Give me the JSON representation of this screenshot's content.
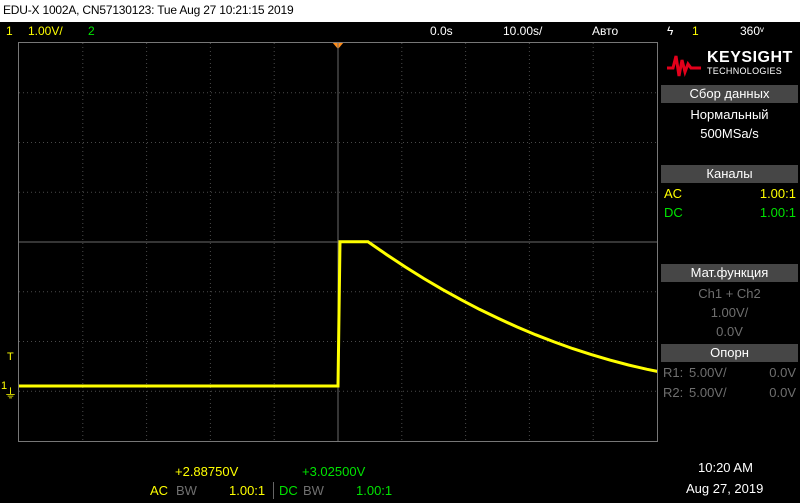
{
  "window": {
    "title": "EDU-X 1002A, CN57130123: Tue Aug 27 10:21:15 2019"
  },
  "status": {
    "ch1_num": "1",
    "ch1_scale": "1.00V/",
    "ch2_num": "2",
    "time_offset": "0.0s",
    "time_scale": "10.00ѕ/",
    "trigger_mode": "Авто",
    "trigger_symbol": "ϟ",
    "trigger_source": "1",
    "trigger_level": "360ᵛ"
  },
  "scope": {
    "pulse": {
      "rise_time_s": 2e-05,
      "fall_time_s": 7e-05,
      "low_level_v": 0.0,
      "high_level_v": 2.9
    },
    "markers": {
      "trigger_tag": "T",
      "ch1_tag": "1",
      "ground_symbol": "⏚"
    }
  },
  "brand": {
    "name": "KEYSIGHT",
    "sub": "TECHNOLOGIES"
  },
  "acquisition": {
    "header": "Сбор данных",
    "mode": "Нормальный",
    "rate": "500MSa/s"
  },
  "channels": {
    "header": "Каналы",
    "ch1_coupling": "AC",
    "ch1_probe": "1.00:1",
    "ch2_coupling": "DC",
    "ch2_probe": "1.00:1"
  },
  "math": {
    "header": "Мат.функция",
    "expr": "Ch1 + Ch2",
    "scale": "1.00V/",
    "offset": "0.0V"
  },
  "ref": {
    "header": "Опорн",
    "r1_label": "R1:",
    "r1_scale": "5.00V/",
    "r1_offset": "0.0V",
    "r2_label": "R2:",
    "r2_scale": "5.00V/",
    "r2_offset": "0.0V"
  },
  "bottom": {
    "ch1_offset": "+2.88750V",
    "ch2_offset": "+3.02500V",
    "ch1_coupling": "AC",
    "ch1_bw": "BW",
    "ch1_probe": "1.00:1",
    "ch2_coupling": "DC",
    "ch2_bw": "BW",
    "ch2_probe": "1.00:1",
    "time": "10:20 AM",
    "date": "Aug 27, 2019"
  },
  "colors": {
    "ch1": "#ffff00",
    "ch2": "#00e400",
    "trigger": "#ff8c1a",
    "header_bg": "#464646"
  }
}
